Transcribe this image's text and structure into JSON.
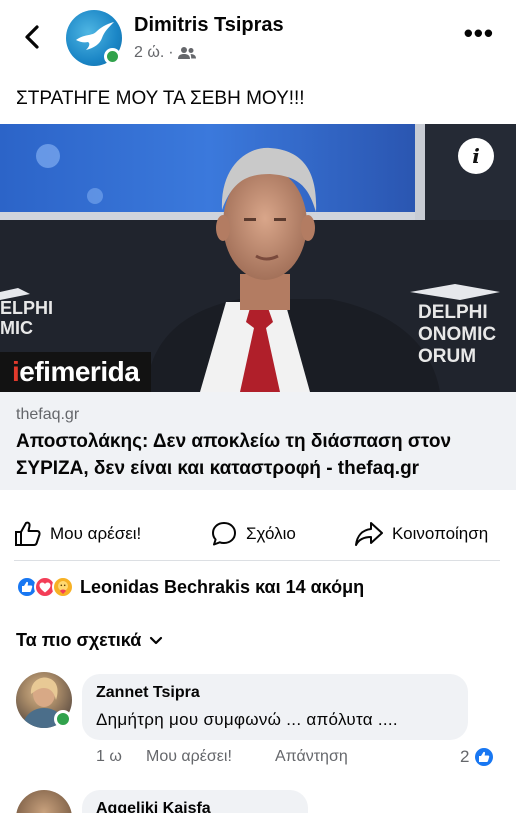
{
  "header": {
    "author": "Dimitris Tsipras",
    "time": "2 ώ.",
    "separator": "·"
  },
  "post": {
    "text": "ΣΤΡΑΤΗΓΕ ΜΟΥ ΤΑ ΣΕΒΗ ΜΟΥ!!!"
  },
  "link": {
    "domain": "thefaq.gr",
    "headline": "Αποστολάκης: Δεν αποκλείω τη διάσπαση στον ΣΥΡΙΖΑ, δεν είναι και καταστροφή - thefaq.gr",
    "watermark_accent": "i",
    "watermark_rest": "efimerida",
    "info_glyph": "i",
    "backdrop_left": "ELPHI\nMIC",
    "backdrop_right": "DELPHI\nONOMIC\nORUM"
  },
  "actions": {
    "like": "Μου αρέσει!",
    "comment": "Σχόλιο",
    "share": "Κοινοποίηση"
  },
  "reactions": {
    "summary": "Leonidas Bechrakis και 14 ακόμη",
    "types": [
      "like",
      "love",
      "care"
    ],
    "colors": {
      "like": "#1877f2",
      "love": "#f33e58",
      "care": "#f7b125"
    }
  },
  "comments_filter": {
    "label": "Τα πιο σχετικά"
  },
  "comments": [
    {
      "name": "Zannet Tsipra",
      "text": "Δημήτρη μου συμφωνώ ... απόλυτα ....",
      "time": "1 ω",
      "like": "Μου αρέσει!",
      "reply": "Απάντηση",
      "reaction_count": "2"
    },
    {
      "name": "Aggeliki Kaisfa"
    }
  ]
}
